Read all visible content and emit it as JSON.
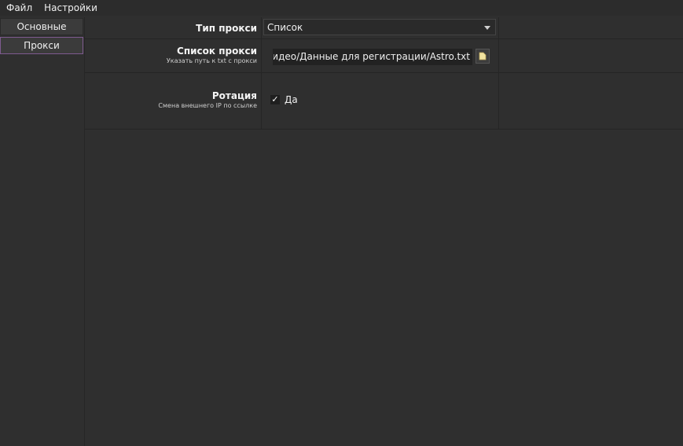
{
  "menu": {
    "file": "Файл",
    "settings": "Настройки"
  },
  "sidebar": {
    "items": [
      {
        "label": "Основные"
      },
      {
        "label": "Прокси"
      }
    ]
  },
  "settings": {
    "proxy_type": {
      "label": "Тип прокси",
      "value": "Список"
    },
    "proxy_list": {
      "label": "Список прокси",
      "sublabel": "Указать путь к txt с прокси",
      "value": "МВидео/Данные для регистрации/Astro.txt"
    },
    "rotation": {
      "label": "Ротация",
      "sublabel": "Смена внешнего IP по ссылке",
      "checkbox_label": "Да",
      "checked": true
    }
  },
  "icons": {
    "browse": "folder-icon",
    "check": "checkmark-icon",
    "dropdown": "chevron-down-icon"
  },
  "colors": {
    "background": "#2f2f2f",
    "active_border": "#7e5a8f"
  }
}
